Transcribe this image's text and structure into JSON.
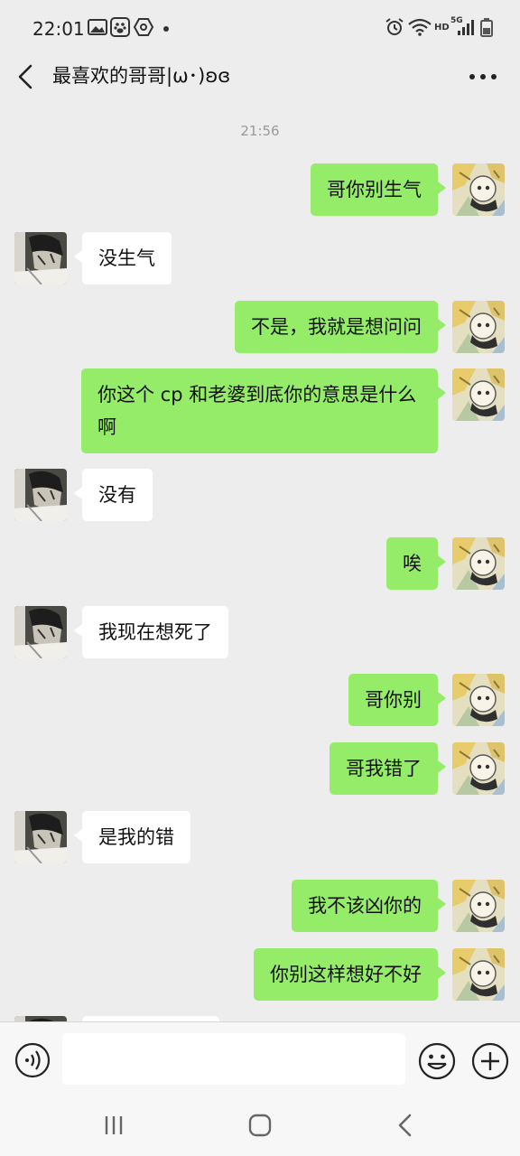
{
  "status_bar": {
    "time": "22:01",
    "hd_label": "HD",
    "network_label": "5G",
    "icons": [
      "gallery-icon",
      "paw-app-icon",
      "hexagon-app-icon",
      "alarm-icon",
      "wifi-icon",
      "signal-icon",
      "battery-icon"
    ]
  },
  "header": {
    "title": "最喜欢的哥哥|ω･)ʚɞ",
    "back_icon": "chevron-left-icon",
    "more_icon": "more-dots-icon"
  },
  "conversation": {
    "timestamp": "21:56",
    "messages": [
      {
        "side": "me",
        "text": "哥你别生气"
      },
      {
        "side": "them",
        "text": "没生气"
      },
      {
        "side": "me",
        "text": "不是，我就是想问问"
      },
      {
        "side": "me",
        "text": "你这个 cp 和老婆到底你的意思是什么啊"
      },
      {
        "side": "them",
        "text": "没有"
      },
      {
        "side": "me",
        "text": "唉"
      },
      {
        "side": "them",
        "text": "我现在想死了"
      },
      {
        "side": "me",
        "text": "哥你别"
      },
      {
        "side": "me",
        "text": "哥我错了"
      },
      {
        "side": "them",
        "text": "是我的错"
      },
      {
        "side": "me",
        "text": "我不该凶你的"
      },
      {
        "side": "me",
        "text": "你别这样想好不好"
      }
    ]
  },
  "input_bar": {
    "value": "",
    "placeholder": "",
    "voice_icon": "voice-icon",
    "emoji_icon": "emoji-icon",
    "plus_icon": "plus-icon"
  },
  "nav_bar": {
    "icons": [
      "recent-apps-icon",
      "home-icon",
      "back-icon"
    ]
  },
  "colors": {
    "background": "#ededed",
    "my_bubble": "#95ec69",
    "their_bubble": "#ffffff"
  }
}
